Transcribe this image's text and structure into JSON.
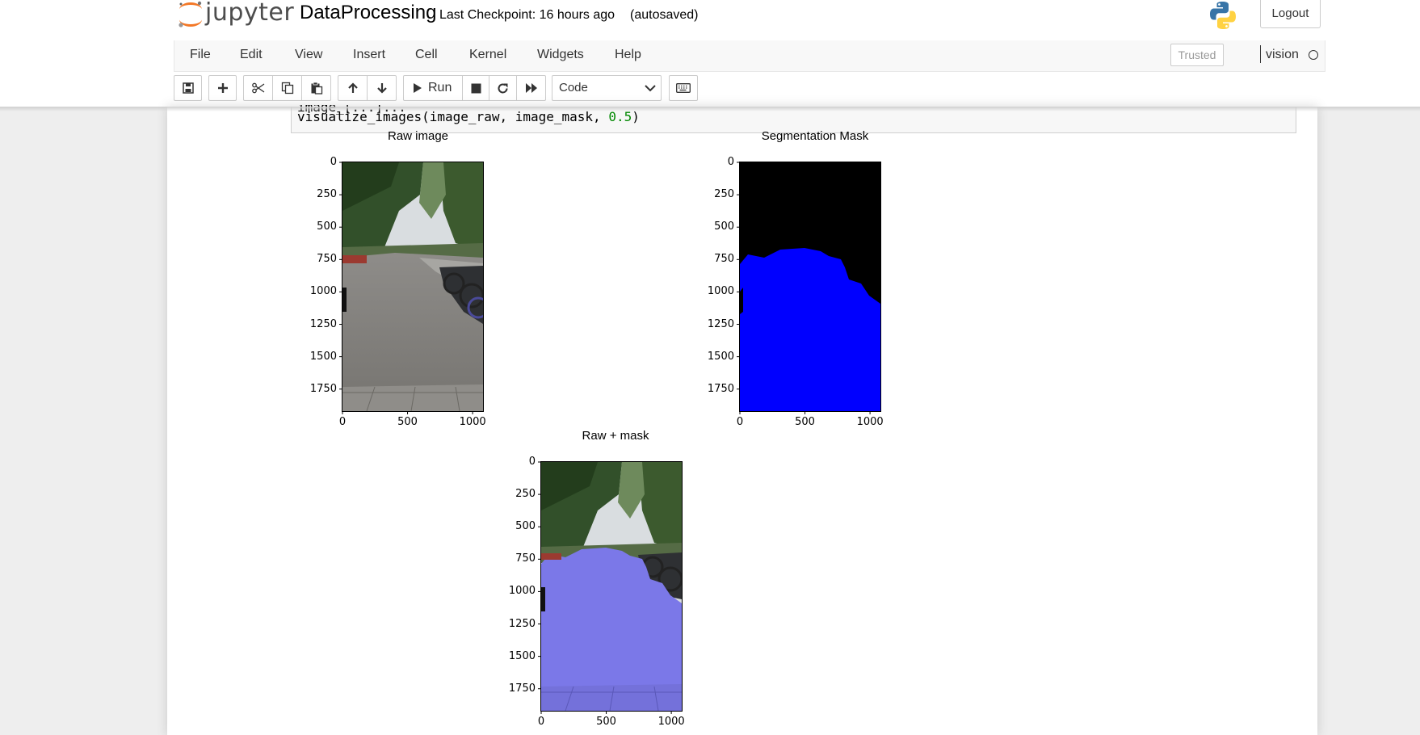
{
  "header": {
    "logo_text": "jupyter",
    "notebook_name": "DataProcessing",
    "checkpoint": "Last Checkpoint: 16 hours ago",
    "autosaved": "(autosaved)",
    "logout_label": "Logout"
  },
  "menu": {
    "items": [
      "File",
      "Edit",
      "View",
      "Insert",
      "Cell",
      "Kernel",
      "Widgets",
      "Help"
    ],
    "trusted_label": "Trusted",
    "kernel_name": "vision"
  },
  "toolbar": {
    "run_label": "Run",
    "cell_type": "Code",
    "icons": [
      "save-icon",
      "plus-icon",
      "cut-icon",
      "copy-icon",
      "paste-icon",
      "arrow-up-icon",
      "arrow-down-icon",
      "run-icon",
      "stop-icon",
      "restart-icon",
      "fast-forward-icon",
      "keyboard-icon"
    ]
  },
  "cell": {
    "code_partial": "image_[...]...",
    "code_prefix": "visualize_images(image_raw, image_mask, ",
    "code_number": "0.5",
    "code_suffix": ")"
  },
  "plots": [
    {
      "title": "Raw image",
      "y_ticks": [
        "0",
        "250",
        "500",
        "750",
        "1000",
        "1250",
        "1500",
        "1750"
      ],
      "x_ticks": [
        "0",
        "500",
        "1000"
      ]
    },
    {
      "title": "Segmentation Mask",
      "y_ticks": [
        "0",
        "250",
        "500",
        "750",
        "1000",
        "1250",
        "1500",
        "1750"
      ],
      "x_ticks": [
        "0",
        "500",
        "1000"
      ]
    },
    {
      "title": "Raw + mask",
      "y_ticks": [
        "0",
        "250",
        "500",
        "750",
        "1000",
        "1250",
        "1500",
        "1750"
      ],
      "x_ticks": [
        "0",
        "500",
        "1000"
      ]
    }
  ],
  "colors": {
    "mask_road": "#0000ff",
    "mask_background": "#000000",
    "overlay_road": "#7b78e8",
    "logo_orange": "#f37726"
  }
}
